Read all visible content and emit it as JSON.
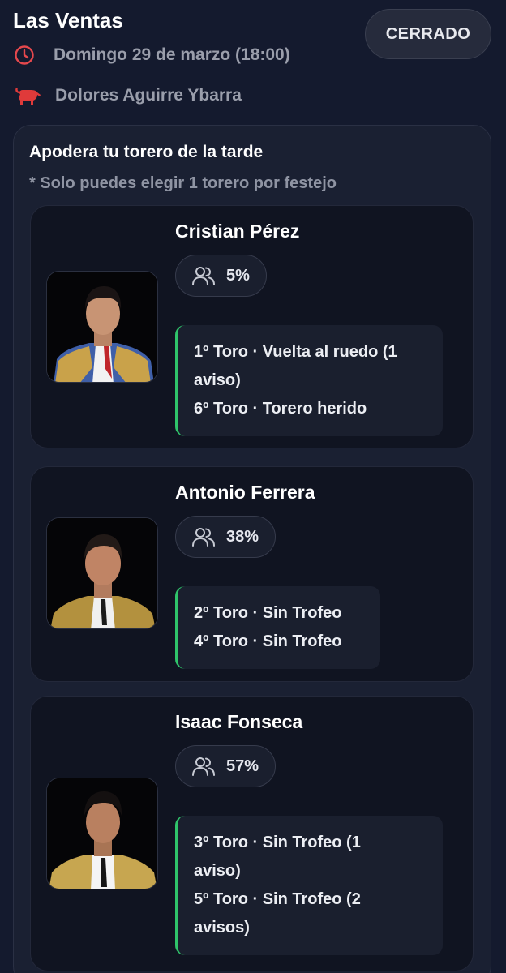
{
  "header": {
    "venue": "Las Ventas",
    "status_label": "CERRADO",
    "date_text": "Domingo 29 de marzo (18:00)",
    "breeder": "Dolores Aguirre Ybarra"
  },
  "section": {
    "title": "Apodera tu torero de la tarde",
    "note": "* Solo puedes elegir 1 torero por festejo"
  },
  "toreros": [
    {
      "name": "Cristian Pérez",
      "percent": "5%",
      "results": [
        "1º Toro · Vuelta al ruedo (1",
        "aviso)",
        "6º Toro · Torero herido"
      ]
    },
    {
      "name": "Antonio Ferrera",
      "percent": "38%",
      "results": [
        "2º Toro · Sin Trofeo",
        "4º Toro · Sin Trofeo"
      ]
    },
    {
      "name": "Isaac Fonseca",
      "percent": "57%",
      "results": [
        "3º Toro · Sin Trofeo (1",
        "aviso)",
        "5º Toro · Sin Trofeo (2",
        "avisos)"
      ]
    }
  ],
  "colors": {
    "background": "#141a2e",
    "card": "#101421",
    "accent_green": "#2fc46a",
    "clock_red": "#e5484d",
    "bull_red": "#e03a3a"
  },
  "icons": {
    "date": "clock-icon",
    "breeder": "bull-icon",
    "percent": "users-icon"
  }
}
